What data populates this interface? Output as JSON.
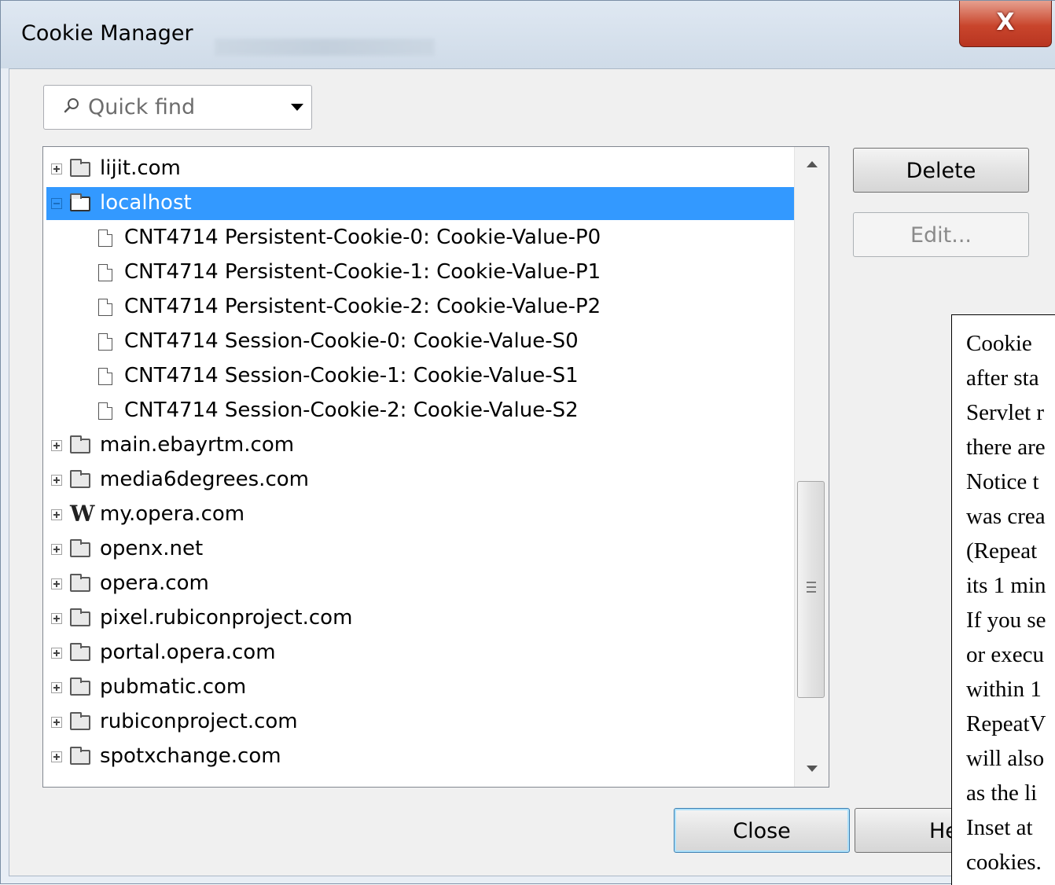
{
  "window": {
    "title": "Cookie Manager",
    "close_glyph": "X"
  },
  "quick_find": {
    "placeholder": "Quick find"
  },
  "tree": {
    "items": [
      {
        "label": "lijit.com",
        "icon": "folder-icon",
        "level": 0,
        "expanded": false,
        "selected": false
      },
      {
        "label": "localhost",
        "icon": "folder-open-icon",
        "level": 0,
        "expanded": true,
        "selected": true
      },
      {
        "label": "CNT4714 Persistent-Cookie-0: Cookie-Value-P0",
        "icon": "cookie-file-icon",
        "level": 1
      },
      {
        "label": "CNT4714 Persistent-Cookie-1: Cookie-Value-P1",
        "icon": "cookie-file-icon",
        "level": 1
      },
      {
        "label": "CNT4714 Persistent-Cookie-2: Cookie-Value-P2",
        "icon": "cookie-file-icon",
        "level": 1
      },
      {
        "label": "CNT4714 Session-Cookie-0: Cookie-Value-S0",
        "icon": "cookie-file-icon",
        "level": 1
      },
      {
        "label": "CNT4714 Session-Cookie-1: Cookie-Value-S1",
        "icon": "cookie-file-icon",
        "level": 1
      },
      {
        "label": "CNT4714 Session-Cookie-2: Cookie-Value-S2",
        "icon": "cookie-file-icon",
        "level": 1
      },
      {
        "label": "main.ebayrtm.com",
        "icon": "folder-icon",
        "level": 0,
        "expanded": false
      },
      {
        "label": "media6degrees.com",
        "icon": "folder-icon",
        "level": 0,
        "expanded": false
      },
      {
        "label": "my.opera.com",
        "icon": "w-icon",
        "level": 0,
        "expanded": false
      },
      {
        "label": "openx.net",
        "icon": "folder-icon",
        "level": 0,
        "expanded": false
      },
      {
        "label": "opera.com",
        "icon": "folder-icon",
        "level": 0,
        "expanded": false
      },
      {
        "label": "pixel.rubiconproject.com",
        "icon": "folder-icon",
        "level": 0,
        "expanded": false
      },
      {
        "label": "portal.opera.com",
        "icon": "folder-icon",
        "level": 0,
        "expanded": false
      },
      {
        "label": "pubmatic.com",
        "icon": "folder-icon",
        "level": 0,
        "expanded": false
      },
      {
        "label": "rubiconproject.com",
        "icon": "folder-icon",
        "level": 0,
        "expanded": false
      },
      {
        "label": "spotxchange.com",
        "icon": "folder-icon",
        "level": 0,
        "expanded": false
      }
    ]
  },
  "buttons": {
    "delete": "Delete",
    "edit": "Edit...",
    "close": "Close",
    "help": "He"
  },
  "annotation": {
    "lines": [
      "Cookie",
      "after sta",
      "Servlet r",
      "there are",
      "Notice t",
      "was crea",
      "(Repeat",
      "its 1 min",
      "If you se",
      "or execu",
      "within 1",
      "RepeatV",
      "will also",
      "as the li",
      "Inset at",
      "cookies."
    ]
  },
  "colors": {
    "selection": "#3399ff",
    "close_button": "#c9452c"
  }
}
